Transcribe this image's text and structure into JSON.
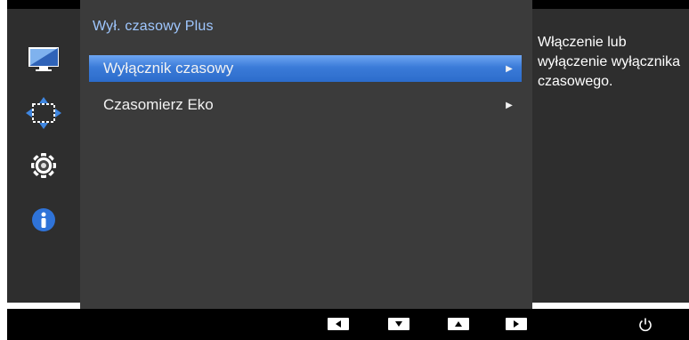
{
  "osd": {
    "panel_title": "Wył. czasowy Plus",
    "menu_items": [
      {
        "label": "Wyłącznik czasowy",
        "selected": true
      },
      {
        "label": "Czasomierz Eko",
        "selected": false
      }
    ],
    "help_text": "Włączenie lub wyłączenie wyłącznika czasowego."
  },
  "sidebar_icons": [
    "monitor-icon",
    "move-arrows-icon",
    "gear-icon",
    "info-icon"
  ],
  "bottom_bar_buttons": [
    "left-arrow-icon",
    "down-arrow-icon",
    "up-arrow-icon",
    "right-arrow-icon",
    "power-icon"
  ],
  "colors": {
    "title": "#9fc7ff",
    "selection": "#3b7bd8",
    "panel": "#3b3b3b",
    "sidebar": "#2e2e2e"
  }
}
